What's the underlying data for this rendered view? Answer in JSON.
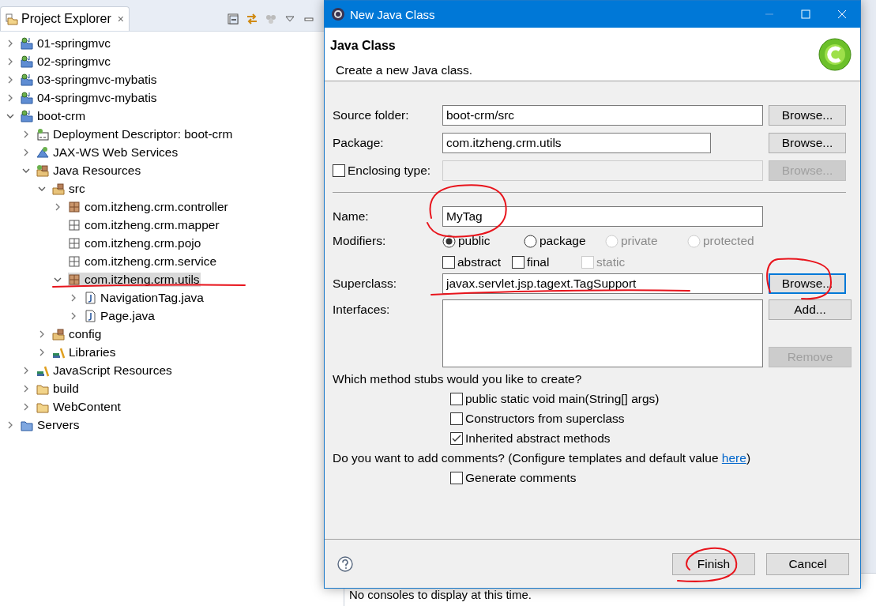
{
  "explorer": {
    "tab": {
      "label": "Project Explorer",
      "close": "×"
    },
    "tree": [
      {
        "label": "01-springmvc",
        "kind": "project",
        "expanded": false,
        "selected": false
      },
      {
        "label": "02-springmvc",
        "kind": "project",
        "expanded": false,
        "selected": false
      },
      {
        "label": "03-springmvc-mybatis",
        "kind": "project",
        "expanded": false,
        "selected": false
      },
      {
        "label": "04-springmvc-mybatis",
        "kind": "project",
        "expanded": false,
        "selected": false
      },
      {
        "label": "boot-crm",
        "kind": "project",
        "expanded": true,
        "selected": false,
        "children": [
          {
            "label": "Deployment Descriptor: boot-crm",
            "kind": "descriptor",
            "expanded": false,
            "selected": false
          },
          {
            "label": "JAX-WS Web Services",
            "kind": "webservices",
            "expanded": false,
            "selected": false
          },
          {
            "label": "Java Resources",
            "kind": "resources",
            "expanded": true,
            "selected": false,
            "children": [
              {
                "label": "src",
                "kind": "srcfolder",
                "expanded": true,
                "selected": false,
                "children": [
                  {
                    "label": "com.itzheng.crm.controller",
                    "kind": "package",
                    "expanded": false,
                    "selected": false
                  },
                  {
                    "label": "com.itzheng.crm.mapper",
                    "kind": "emptypackage",
                    "selected": false
                  },
                  {
                    "label": "com.itzheng.crm.pojo",
                    "kind": "emptypackage",
                    "selected": false
                  },
                  {
                    "label": "com.itzheng.crm.service",
                    "kind": "emptypackage",
                    "selected": false
                  },
                  {
                    "label": "com.itzheng.crm.utils",
                    "kind": "package",
                    "expanded": true,
                    "selected": true,
                    "children": [
                      {
                        "label": "NavigationTag.java",
                        "kind": "javafile",
                        "expanded": false,
                        "selected": false
                      },
                      {
                        "label": "Page.java",
                        "kind": "javafile",
                        "expanded": false,
                        "selected": false
                      }
                    ]
                  }
                ]
              },
              {
                "label": "config",
                "kind": "srcfolder",
                "expanded": false,
                "selected": false
              },
              {
                "label": "Libraries",
                "kind": "libraries",
                "expanded": false,
                "selected": false
              }
            ]
          },
          {
            "label": "JavaScript Resources",
            "kind": "libraries",
            "expanded": false,
            "selected": false
          },
          {
            "label": "build",
            "kind": "folder",
            "expanded": false,
            "selected": false
          },
          {
            "label": "WebContent",
            "kind": "folder",
            "expanded": false,
            "selected": false
          }
        ]
      },
      {
        "label": "Servers",
        "kind": "servers",
        "expanded": false,
        "selected": false
      }
    ]
  },
  "console": {
    "message": "No consoles to display at this time."
  },
  "dialog": {
    "title": "New Java Class",
    "header": {
      "title": "Java Class",
      "message": "Create a new Java class."
    },
    "rows": [
      {
        "kind": "field",
        "label": "Source folder:",
        "value": "boot-crm/src",
        "wide": true,
        "button": {
          "label": "Browse...",
          "disabled": false,
          "focused": false
        }
      },
      {
        "kind": "field",
        "label": "Package:",
        "value": "com.itzheng.crm.utils",
        "wide": false,
        "button": {
          "label": "Browse...",
          "disabled": false,
          "focused": false
        }
      },
      {
        "kind": "checkfield",
        "label": "Enclosing type:",
        "checked": false,
        "button": {
          "label": "Browse...",
          "disabled": true,
          "focused": false
        }
      },
      {
        "kind": "separator"
      },
      {
        "kind": "field",
        "label": "Name:",
        "value": "MyTag",
        "wide": true
      },
      {
        "kind": "radios",
        "label": "Modifiers:",
        "options": [
          {
            "label": "public",
            "selected": true,
            "disabled": false
          },
          {
            "label": "package",
            "selected": false,
            "disabled": false
          },
          {
            "label": "private",
            "selected": false,
            "disabled": true
          },
          {
            "label": "protected",
            "selected": false,
            "disabled": true
          }
        ]
      },
      {
        "kind": "checks",
        "options": [
          {
            "label": "abstract",
            "checked": false,
            "disabled": false
          },
          {
            "label": "final",
            "checked": false,
            "disabled": false
          },
          {
            "label": "static",
            "checked": false,
            "disabled": true
          }
        ]
      },
      {
        "kind": "field",
        "label": "Superclass:",
        "value": "javax.servlet.jsp.tagext.TagSupport",
        "wide": true,
        "button": {
          "label": "Browse...",
          "disabled": false,
          "focused": true
        }
      },
      {
        "kind": "list",
        "label": "Interfaces:",
        "buttons": [
          {
            "label": "Add...",
            "disabled": false
          },
          {
            "label": "Remove",
            "disabled": true
          }
        ]
      }
    ],
    "stubs": {
      "question": "Which method stubs would you like to create?",
      "options": [
        {
          "label": "public static void main(String[] args)",
          "checked": false
        },
        {
          "label": "Constructors from superclass",
          "checked": false
        },
        {
          "label": "Inherited abstract methods",
          "checked": true
        }
      ]
    },
    "comments": {
      "text": "Do you want to add comments? (Configure templates and default value ",
      "link": "here",
      "after": ")",
      "options": [
        {
          "label": "Generate comments",
          "checked": false
        }
      ]
    },
    "buttons": [
      {
        "label": "Finish",
        "default": false
      },
      {
        "label": "Cancel",
        "default": false
      }
    ]
  }
}
